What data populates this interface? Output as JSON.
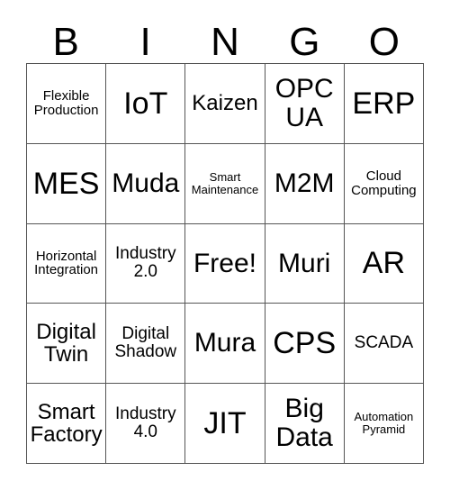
{
  "card": {
    "header_letters": [
      "B",
      "I",
      "N",
      "G",
      "O"
    ],
    "rows": [
      [
        {
          "label": "Flexible Production",
          "size": "xs"
        },
        {
          "label": "IoT",
          "size": "xl"
        },
        {
          "label": "Kaizen",
          "size": "md"
        },
        {
          "label": "OPC UA",
          "size": "lg"
        },
        {
          "label": "ERP",
          "size": "xl"
        }
      ],
      [
        {
          "label": "MES",
          "size": "xl"
        },
        {
          "label": "Muda",
          "size": "lg"
        },
        {
          "label": "Smart Maintenance",
          "size": "xxs"
        },
        {
          "label": "M2M",
          "size": "lg"
        },
        {
          "label": "Cloud Computing",
          "size": "xs"
        }
      ],
      [
        {
          "label": "Horizontal Integration",
          "size": "xs"
        },
        {
          "label": "Industry 2.0",
          "size": "sm"
        },
        {
          "label": "Free!",
          "size": "lg"
        },
        {
          "label": "Muri",
          "size": "lg"
        },
        {
          "label": "AR",
          "size": "xl"
        }
      ],
      [
        {
          "label": "Digital Twin",
          "size": "md"
        },
        {
          "label": "Digital Shadow",
          "size": "sm"
        },
        {
          "label": "Mura",
          "size": "lg"
        },
        {
          "label": "CPS",
          "size": "xl"
        },
        {
          "label": "SCADA",
          "size": "sm"
        }
      ],
      [
        {
          "label": "Smart Factory",
          "size": "md"
        },
        {
          "label": "Industry 4.0",
          "size": "sm"
        },
        {
          "label": "JIT",
          "size": "xl"
        },
        {
          "label": "Big Data",
          "size": "lg"
        },
        {
          "label": "Automation Pyramid",
          "size": "xxs"
        }
      ]
    ],
    "colors": {
      "background": "#ffffff",
      "text": "#000000",
      "grid_line": "#555555"
    }
  }
}
